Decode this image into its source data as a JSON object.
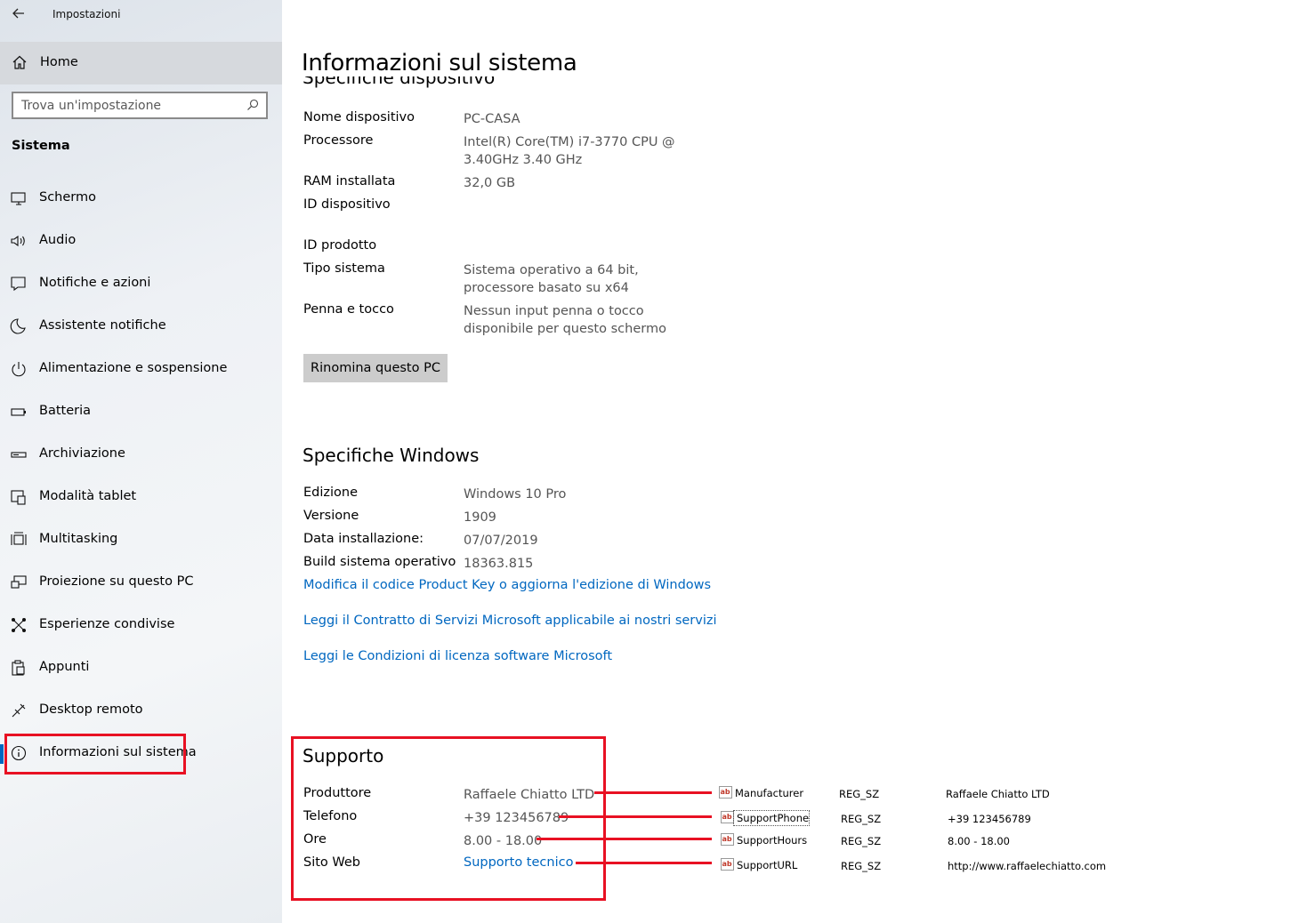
{
  "window": {
    "title": "Impostazioni"
  },
  "sidebar": {
    "home_label": "Home",
    "search_placeholder": "Trova un'impostazione",
    "section_title": "Sistema",
    "items": [
      {
        "label": "Schermo",
        "icon": "display-icon"
      },
      {
        "label": "Audio",
        "icon": "speaker-icon"
      },
      {
        "label": "Notifiche e azioni",
        "icon": "notification-icon"
      },
      {
        "label": "Assistente notifiche",
        "icon": "moon-icon"
      },
      {
        "label": "Alimentazione e sospensione",
        "icon": "power-icon"
      },
      {
        "label": "Batteria",
        "icon": "battery-icon"
      },
      {
        "label": "Archiviazione",
        "icon": "storage-icon"
      },
      {
        "label": "Modalità tablet",
        "icon": "tablet-icon"
      },
      {
        "label": "Multitasking",
        "icon": "multitasking-icon"
      },
      {
        "label": "Proiezione su questo PC",
        "icon": "projection-icon"
      },
      {
        "label": "Esperienze condivise",
        "icon": "shared-icon"
      },
      {
        "label": "Appunti",
        "icon": "clipboard-icon"
      },
      {
        "label": "Desktop remoto",
        "icon": "remote-desktop-icon"
      },
      {
        "label": "Informazioni sul sistema",
        "icon": "info-icon",
        "selected": true
      }
    ]
  },
  "main": {
    "title": "Informazioni sul sistema",
    "device_specs": {
      "heading_clipped": "Specifiche dispositivo",
      "rows": [
        {
          "label": "Nome dispositivo",
          "value": "PC-CASA"
        },
        {
          "label": "Processore",
          "value": "Intel(R) Core(TM) i7-3770 CPU @ 3.40GHz   3.40 GHz"
        },
        {
          "label": "RAM installata",
          "value": "32,0 GB"
        },
        {
          "label": "ID dispositivo",
          "value": ""
        },
        {
          "label": "ID prodotto",
          "value": ""
        },
        {
          "label": "Tipo sistema",
          "value": "Sistema operativo a 64 bit, processore basato su x64"
        },
        {
          "label": "Penna e tocco",
          "value": "Nessun input penna o tocco disponibile per questo schermo"
        }
      ],
      "rename_button": "Rinomina questo PC"
    },
    "windows_specs": {
      "heading": "Specifiche Windows",
      "rows": [
        {
          "label": "Edizione",
          "value": "Windows 10 Pro"
        },
        {
          "label": "Versione",
          "value": "1909"
        },
        {
          "label": "Data installazione:",
          "value": "07/07/2019"
        },
        {
          "label": "Build sistema operativo",
          "value": "18363.815"
        }
      ],
      "links": [
        "Modifica il codice Product Key o aggiorna l'edizione di Windows",
        "Leggi il Contratto di Servizi Microsoft applicabile ai nostri servizi",
        "Leggi le Condizioni di licenza software Microsoft"
      ]
    },
    "support": {
      "heading": "Supporto",
      "rows": [
        {
          "label": "Produttore",
          "value": "Raffaele Chiatto LTD"
        },
        {
          "label": "Telefono",
          "value": "+39 123456789"
        },
        {
          "label": "Ore",
          "value": "8.00 - 18.00"
        },
        {
          "label": "Sito Web",
          "value": "Supporto tecnico"
        }
      ]
    }
  },
  "registry": {
    "icon": "reg-string-icon",
    "entries": [
      {
        "name": "Manufacturer",
        "type": "REG_SZ",
        "data": "Raffaele Chiatto LTD"
      },
      {
        "name": "SupportPhone",
        "type": "REG_SZ",
        "data": "+39 123456789"
      },
      {
        "name": "SupportHours",
        "type": "REG_SZ",
        "data": "8.00 - 18.00"
      },
      {
        "name": "SupportURL",
        "type": "REG_SZ",
        "data": "http://www.raffaelechiatto.com"
      }
    ]
  },
  "colors": {
    "accent": "#0067c0",
    "highlight_red": "#e81123",
    "value_gray": "#555555"
  }
}
